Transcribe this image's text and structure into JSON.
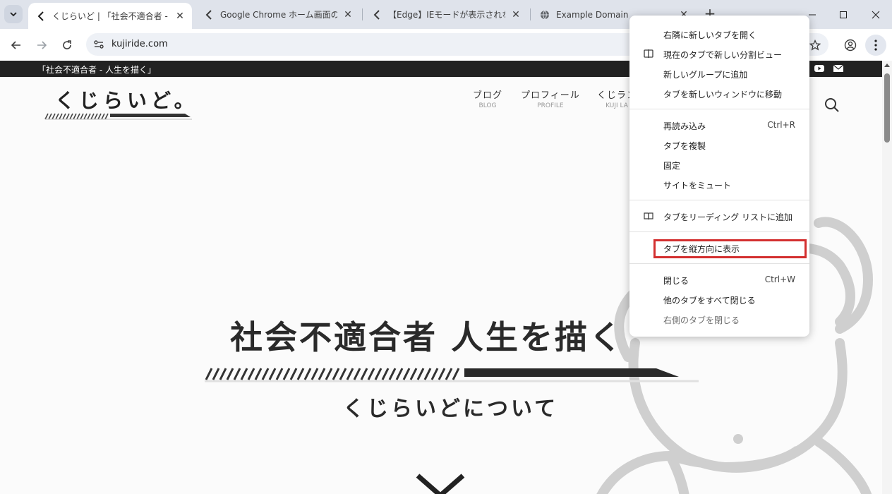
{
  "browser": {
    "tabs": [
      {
        "title": "くじらいど | 「社会不適合者 - 人生",
        "active": true
      },
      {
        "title": "Google Chrome ホーム画面の背景",
        "active": false
      },
      {
        "title": "【Edge】IEモードが表示されない･再",
        "active": false
      },
      {
        "title": "Example Domain",
        "active": false
      }
    ],
    "new_tab": "+",
    "address": {
      "url": "kujiride.com"
    }
  },
  "page": {
    "tagline": "「社会不適合者 - 人生を描く」",
    "logo": "くじらいど。",
    "nav": [
      {
        "jp": "ブログ",
        "en": "BLOG"
      },
      {
        "jp": "プロフィール",
        "en": "PROFILE"
      },
      {
        "jp": "くじラン",
        "en": "KUJI LA"
      }
    ],
    "hero_title": "社会不適合者 人生を描く",
    "hero_subtitle": "くじらいどについて"
  },
  "context_menu": {
    "items": [
      {
        "label": "右隣に新しいタブを開く",
        "shortcut": ""
      },
      {
        "label": "現在のタブで新しい分割ビュー",
        "shortcut": "",
        "icon": "split-view-icon"
      },
      {
        "label": "新しいグループに追加",
        "shortcut": ""
      },
      {
        "label": "タブを新しいウィンドウに移動",
        "shortcut": ""
      },
      {
        "label": "再読み込み",
        "shortcut": "Ctrl+R"
      },
      {
        "label": "タブを複製",
        "shortcut": ""
      },
      {
        "label": "固定",
        "shortcut": ""
      },
      {
        "label": "サイトをミュート",
        "shortcut": ""
      },
      {
        "label": "タブをリーディング リストに追加",
        "shortcut": "",
        "icon": "reading-list-icon"
      },
      {
        "label": "タブを縦方向に表示",
        "shortcut": "",
        "highlighted": true
      },
      {
        "label": "閉じる",
        "shortcut": "Ctrl+W"
      },
      {
        "label": "他のタブをすべて閉じる",
        "shortcut": ""
      },
      {
        "label": "右側のタブを閉じる",
        "shortcut": "",
        "disabled": true
      }
    ]
  },
  "colors": {
    "highlight": "#d32f2f",
    "topbar": "#222222",
    "tabstrip": "#dfe3eb"
  }
}
